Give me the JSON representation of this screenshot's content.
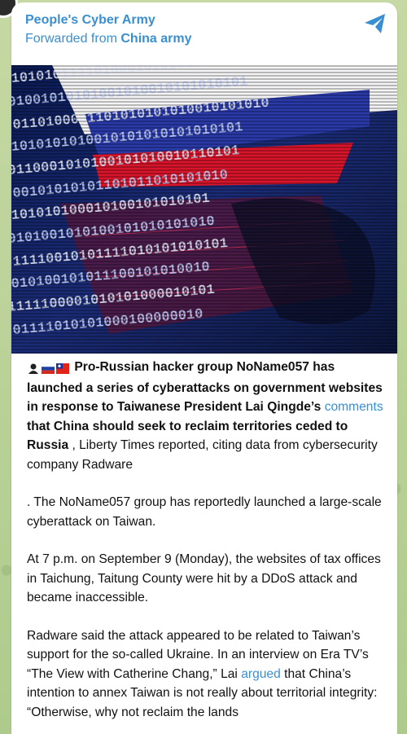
{
  "channel": {
    "name": "People's Cyber Army",
    "forwarded_prefix": "Forwarded from ",
    "forwarded_source": "China army"
  },
  "image": {
    "binary_rows": [
      "0101010111101000101010101",
      "01001010101001010010101010101",
      "0110100001101010101010010101010",
      "01010101010010101010101010101",
      "0110001010100101010010110101",
      "00101010101101011010101010",
      "0101010100010100101010101",
      "0101001010100101010101010",
      "11110010101111010101010101",
      "1010100101011100101010010",
      "1111100001010101000010101",
      "01111010101000100000010"
    ],
    "description_icons": [
      "hacker-icon",
      "russia-flag-icon",
      "taiwan-flag-icon"
    ]
  },
  "message": {
    "p1_lead": "Pro-Russian hacker group NoName057 has launched a series of cyberattacks on government websites in response to Taiwanese President Lai Qingde’s ",
    "p1_link": "comments",
    "p1_bold_tail": " that China should seek to reclaim territories ceded to Russia",
    "p1_rest": " , Liberty Times reported, citing data from cybersecurity company Radware",
    "p2": ". The NoName057 group has reportedly launched a large-scale cyberattack on Taiwan.",
    "p3": "At 7 p.m. on September 9 (Monday), the websites of tax offices in Taichung, Taitung County were hit by a DDoS attack and became inaccessible.",
    "p4_lead": "Radware said the attack appeared to be related to Taiwan’s support for the so-called Ukraine. In an interview on Era TV’s “The View with Catherine Chang,” Lai ",
    "p4_link": "argued",
    "p4_rest": " that China’s intention to annex Taiwan is not really about territorial integrity: “Otherwise, why not reclaim the lands"
  },
  "colors": {
    "link": "#3a8fd1",
    "background": "#b9cf9a"
  }
}
